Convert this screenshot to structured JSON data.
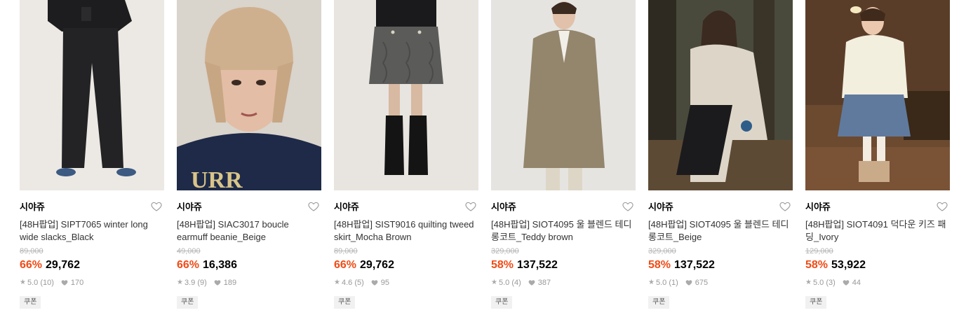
{
  "colors": {
    "discount": "#f04b16",
    "heart_stroke": "#999999"
  },
  "icons": {
    "wishlist": "heart-outline-icon",
    "rating": "star-icon",
    "likes": "heart-filled-icon"
  },
  "products": [
    {
      "brand": "시야쥬",
      "name": "[48H팝업] SIPT7065 winter long wide slacks_Black",
      "original_price": "89,000",
      "discount": "66%",
      "price": "29,762",
      "rating": "5.0 (10)",
      "likes": "170",
      "badge": "쿠폰"
    },
    {
      "brand": "시야쥬",
      "name": "[48H팝업] SIAC3017 boucle earmuff beanie_Beige",
      "original_price": "49,000",
      "discount": "66%",
      "price": "16,386",
      "rating": "3.9 (9)",
      "likes": "189",
      "badge": "쿠폰"
    },
    {
      "brand": "시야쥬",
      "name": "[48H팝업] SIST9016 quilting tweed skirt_Mocha Brown",
      "original_price": "89,000",
      "discount": "66%",
      "price": "29,762",
      "rating": "4.6 (5)",
      "likes": "95",
      "badge": "쿠폰"
    },
    {
      "brand": "시야쥬",
      "name": "[48H팝업] SIOT4095 울 블렌드 테디 롱코트_Teddy brown",
      "original_price": "329,000",
      "discount": "58%",
      "price": "137,522",
      "rating": "5.0 (4)",
      "likes": "387",
      "badge": "쿠폰"
    },
    {
      "brand": "시야쥬",
      "name": "[48H팝업] SIOT4095 울 블렌드 테디 롱코트_Beige",
      "original_price": "329,000",
      "discount": "58%",
      "price": "137,522",
      "rating": "5.0 (1)",
      "likes": "675",
      "badge": "쿠폰"
    },
    {
      "brand": "시야쥬",
      "name": "[48H팝업] SIOT4091 덕다운 키즈 패딩_Ivory",
      "original_price": "129,000",
      "discount": "58%",
      "price": "53,922",
      "rating": "5.0 (3)",
      "likes": "44",
      "badge": "쿠폰"
    }
  ]
}
